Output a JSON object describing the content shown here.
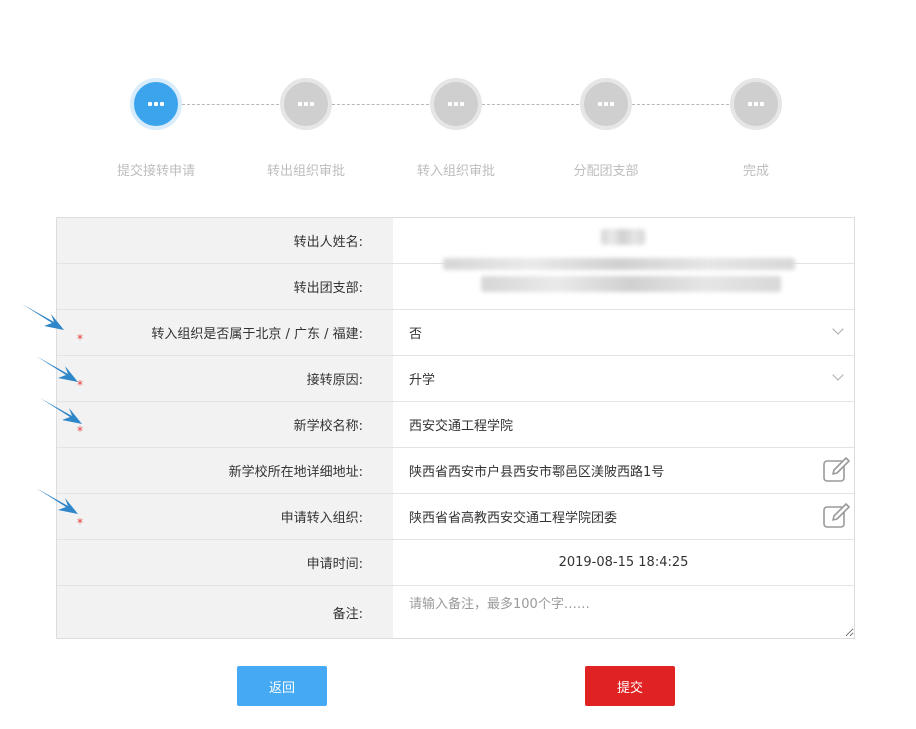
{
  "stepper": {
    "steps": [
      {
        "label": "提交接转申请",
        "active": true
      },
      {
        "label": "转出组织审批",
        "active": false
      },
      {
        "label": "转入组织审批",
        "active": false
      },
      {
        "label": "分配团支部",
        "active": false
      },
      {
        "label": "完成",
        "active": false
      }
    ]
  },
  "form": {
    "transfer_name": {
      "label": "转出人姓名:"
    },
    "transfer_branch": {
      "label": "转出团支部:"
    },
    "region_question": {
      "label": "转入组织是否属于北京 / 广东 / 福建:",
      "value": "否"
    },
    "reason": {
      "label": "接转原因:",
      "value": "升学"
    },
    "new_school": {
      "label": "新学校名称:",
      "value": "西安交通工程学院"
    },
    "school_address": {
      "label": "新学校所在地详细地址:",
      "value": "陕西省西安市户县西安市鄠邑区渼陂西路1号"
    },
    "target_org": {
      "label": "申请转入组织:",
      "value": "陕西省省高教西安交通工程学院团委"
    },
    "apply_time": {
      "label": "申请时间:",
      "value": "2019-08-15 18:4:25"
    },
    "remark": {
      "label": "备注:",
      "placeholder": "请输入备注，最多100个字……"
    },
    "required_mark": "*"
  },
  "buttons": {
    "back": "返回",
    "submit": "提交"
  },
  "colors": {
    "active_step": "#3ba4ec",
    "inactive_step": "#cfcfcf",
    "back_button": "#46a9f3",
    "submit_button": "#e12222",
    "required": "#e33b3b",
    "annotation_arrow": "#2f86c9"
  }
}
